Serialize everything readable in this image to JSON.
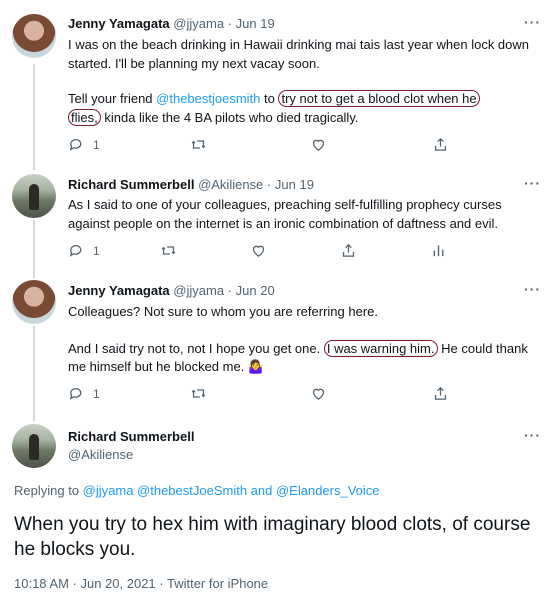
{
  "tweets": [
    {
      "name": "Jenny Yamagata",
      "handle": "@jjyama",
      "sep": "·",
      "date": "Jun 19",
      "line1": "I was on the beach drinking in Hawaii drinking mai tais last year when lock down started. I'll be planning my next vacay soon.",
      "p2_pre": "Tell your friend ",
      "p2_mention": "@thebestjoesmith",
      "p2_to": " to ",
      "p2_circled1": "try not to get a blood clot when he",
      "p2_circled2": "flies,",
      "p2_post": " kinda like the 4 BA pilots who died tragically.",
      "replies": "1"
    },
    {
      "name": "Richard Summerbell",
      "handle": "@Akiliense",
      "sep": "·",
      "date": "Jun 19",
      "text": "As I said to one of your colleagues, preaching self-fulfilling prophecy curses against people on the internet is an ironic combination of daftness and evil.",
      "replies": "1"
    },
    {
      "name": "Jenny Yamagata",
      "handle": "@jjyama",
      "sep": "·",
      "date": "Jun 20",
      "p1": "Colleagues? Not sure to whom you are referring here.",
      "p2_pre": "And I said try not to, not I hope you get one. ",
      "p2_circled": "I was warning him.",
      "p2_post": " He could thank me himself but he blocked me. 🤷‍♀️",
      "replies": "1"
    }
  ],
  "main_tweet": {
    "name": "Richard Summerbell",
    "handle": "@Akiliense",
    "replying_prefix": "Replying to ",
    "replying_targets": "@jjyama @thebestJoeSmith and @Elanders_Voice",
    "text": "When you try to hex him with imaginary blood clots, of course he blocks you.",
    "timestamp": "10:18 AM · Jun 20, 2021 · Twitter for iPhone"
  },
  "icons": {
    "reply": "reply-icon",
    "retweet": "retweet-icon",
    "like": "like-icon",
    "share": "share-icon",
    "analytics": "analytics-icon",
    "more": "more-icon"
  },
  "colors": {
    "link": "#1d9bf0",
    "secondary_text": "#536471",
    "circle_annotation": "#7c1d2a"
  }
}
